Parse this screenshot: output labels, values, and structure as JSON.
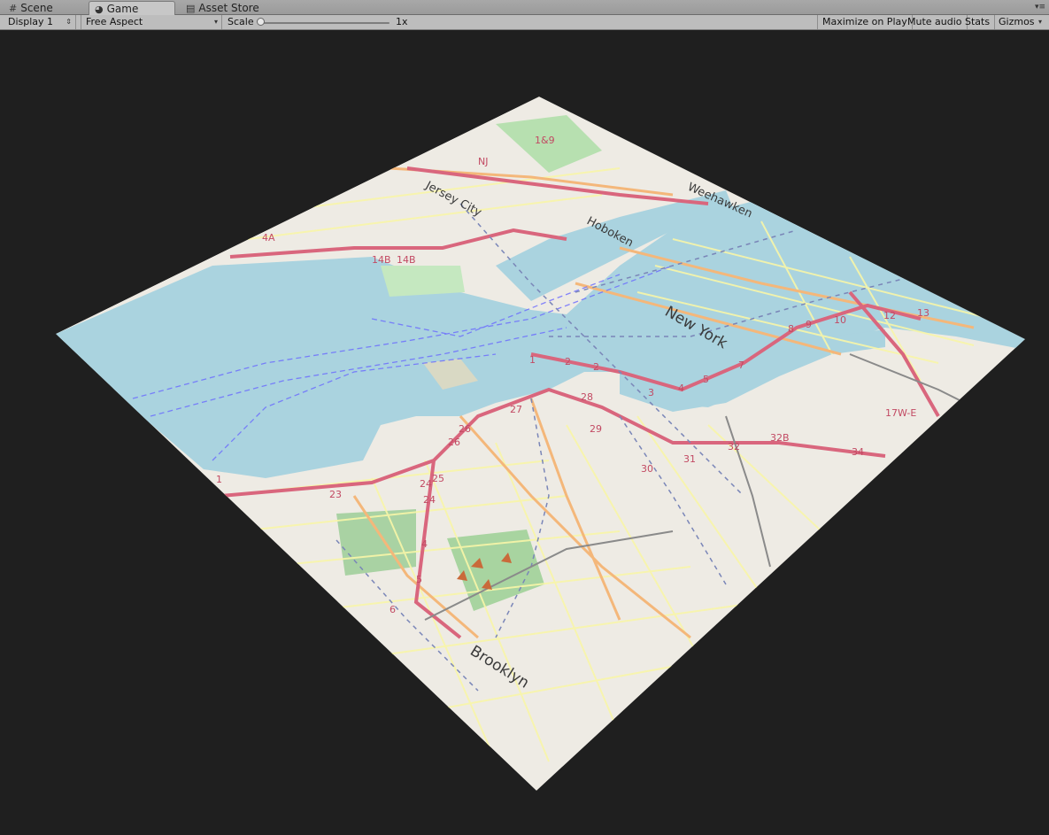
{
  "tabs": {
    "scene": {
      "label": "Scene",
      "icon": "grid-icon"
    },
    "game": {
      "label": "Game",
      "icon": "pacman-icon"
    },
    "asset_store": {
      "label": "Asset Store",
      "icon": "store-bag-icon"
    }
  },
  "toolbar": {
    "display": "Display 1",
    "aspect": "Free Aspect",
    "scale_label": "Scale",
    "scale_value": "1x",
    "scale_fraction": 0.0,
    "maximize": "Maximize on Play",
    "mute": "Mute audio",
    "stats": "Stats",
    "gizmos": "Gizmos"
  },
  "map": {
    "places": {
      "jersey_city": "Jersey City",
      "hoboken": "Hoboken",
      "weehawken": "Weehawken",
      "new_york": "New York",
      "brooklyn": "Brooklyn"
    },
    "route_labels": [
      "NJ",
      "1&9",
      "4A",
      "14B",
      "14B",
      "1",
      "2",
      "2",
      "3",
      "4",
      "5",
      "7",
      "8",
      "9",
      "10",
      "12",
      "13",
      "28",
      "29",
      "30",
      "31",
      "32",
      "32B",
      "34",
      "17W-E",
      "27",
      "26",
      "26",
      "25",
      "24",
      "24",
      "23",
      "1",
      "4",
      "5",
      "6"
    ],
    "colors": {
      "viewport_bg": "#1f1f1f",
      "water": "#aad3df",
      "land": "#f2efe9",
      "highway": "#e892a2",
      "primary_road": "#fcd6a4",
      "secondary_road": "#f7fabf",
      "park": "#c8facc",
      "wood": "#add19e",
      "ferry": "#6a6aff",
      "railway": "#8a8a8a"
    }
  }
}
